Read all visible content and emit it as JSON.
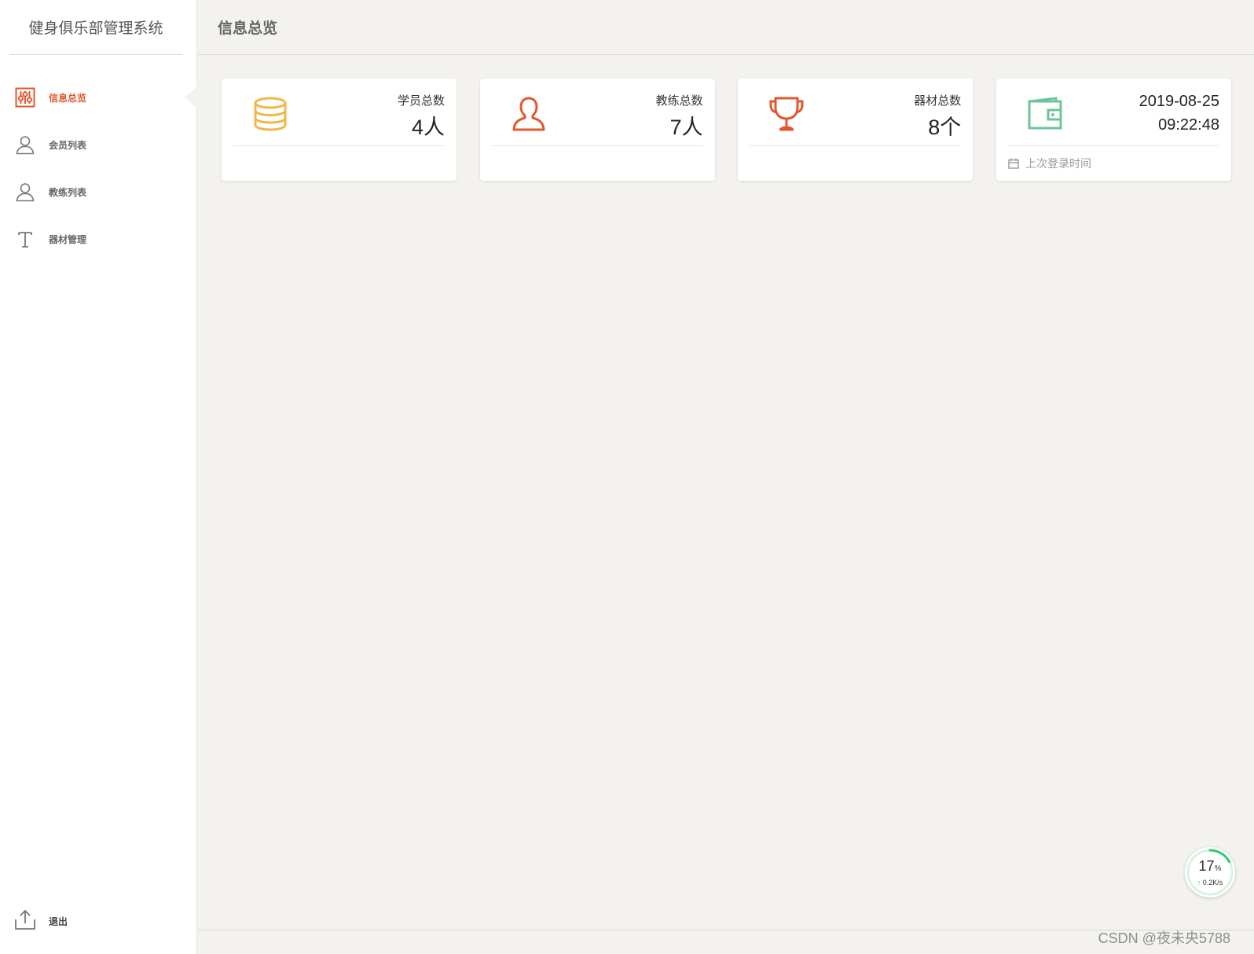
{
  "app": {
    "title": "健身俱乐部管理系统"
  },
  "sidebar": {
    "items": [
      {
        "label": "信息总览",
        "icon": "sliders-icon",
        "active": true
      },
      {
        "label": "会员列表",
        "icon": "user-icon",
        "active": false
      },
      {
        "label": "教练列表",
        "icon": "user-icon",
        "active": false
      },
      {
        "label": "器材管理",
        "icon": "text-t-icon",
        "active": false
      }
    ],
    "logout_label": "退出"
  },
  "header": {
    "title": "信息总览"
  },
  "cards": [
    {
      "label": "学员总数",
      "value": "4人",
      "icon": "database-icon",
      "color": "#f0b74a"
    },
    {
      "label": "教练总数",
      "value": "7人",
      "icon": "user-icon",
      "color": "#e4572e"
    },
    {
      "label": "器材总数",
      "value": "8个",
      "icon": "trophy-icon",
      "color": "#e4572e"
    },
    {
      "date": "2019-08-25",
      "time": "09:22:48",
      "footer": "上次登录时间",
      "icon": "wallet-icon",
      "color": "#6cc49a"
    }
  ],
  "speed_widget": {
    "percent": "17",
    "percent_unit": "%",
    "rate_arrow": "↑",
    "rate": "0.2K/s",
    "fraction": 0.17,
    "color": "#2ecc71"
  },
  "watermark": "CSDN @夜未央5788",
  "colors": {
    "accent": "#e4572e",
    "background": "#f3f2ee"
  }
}
